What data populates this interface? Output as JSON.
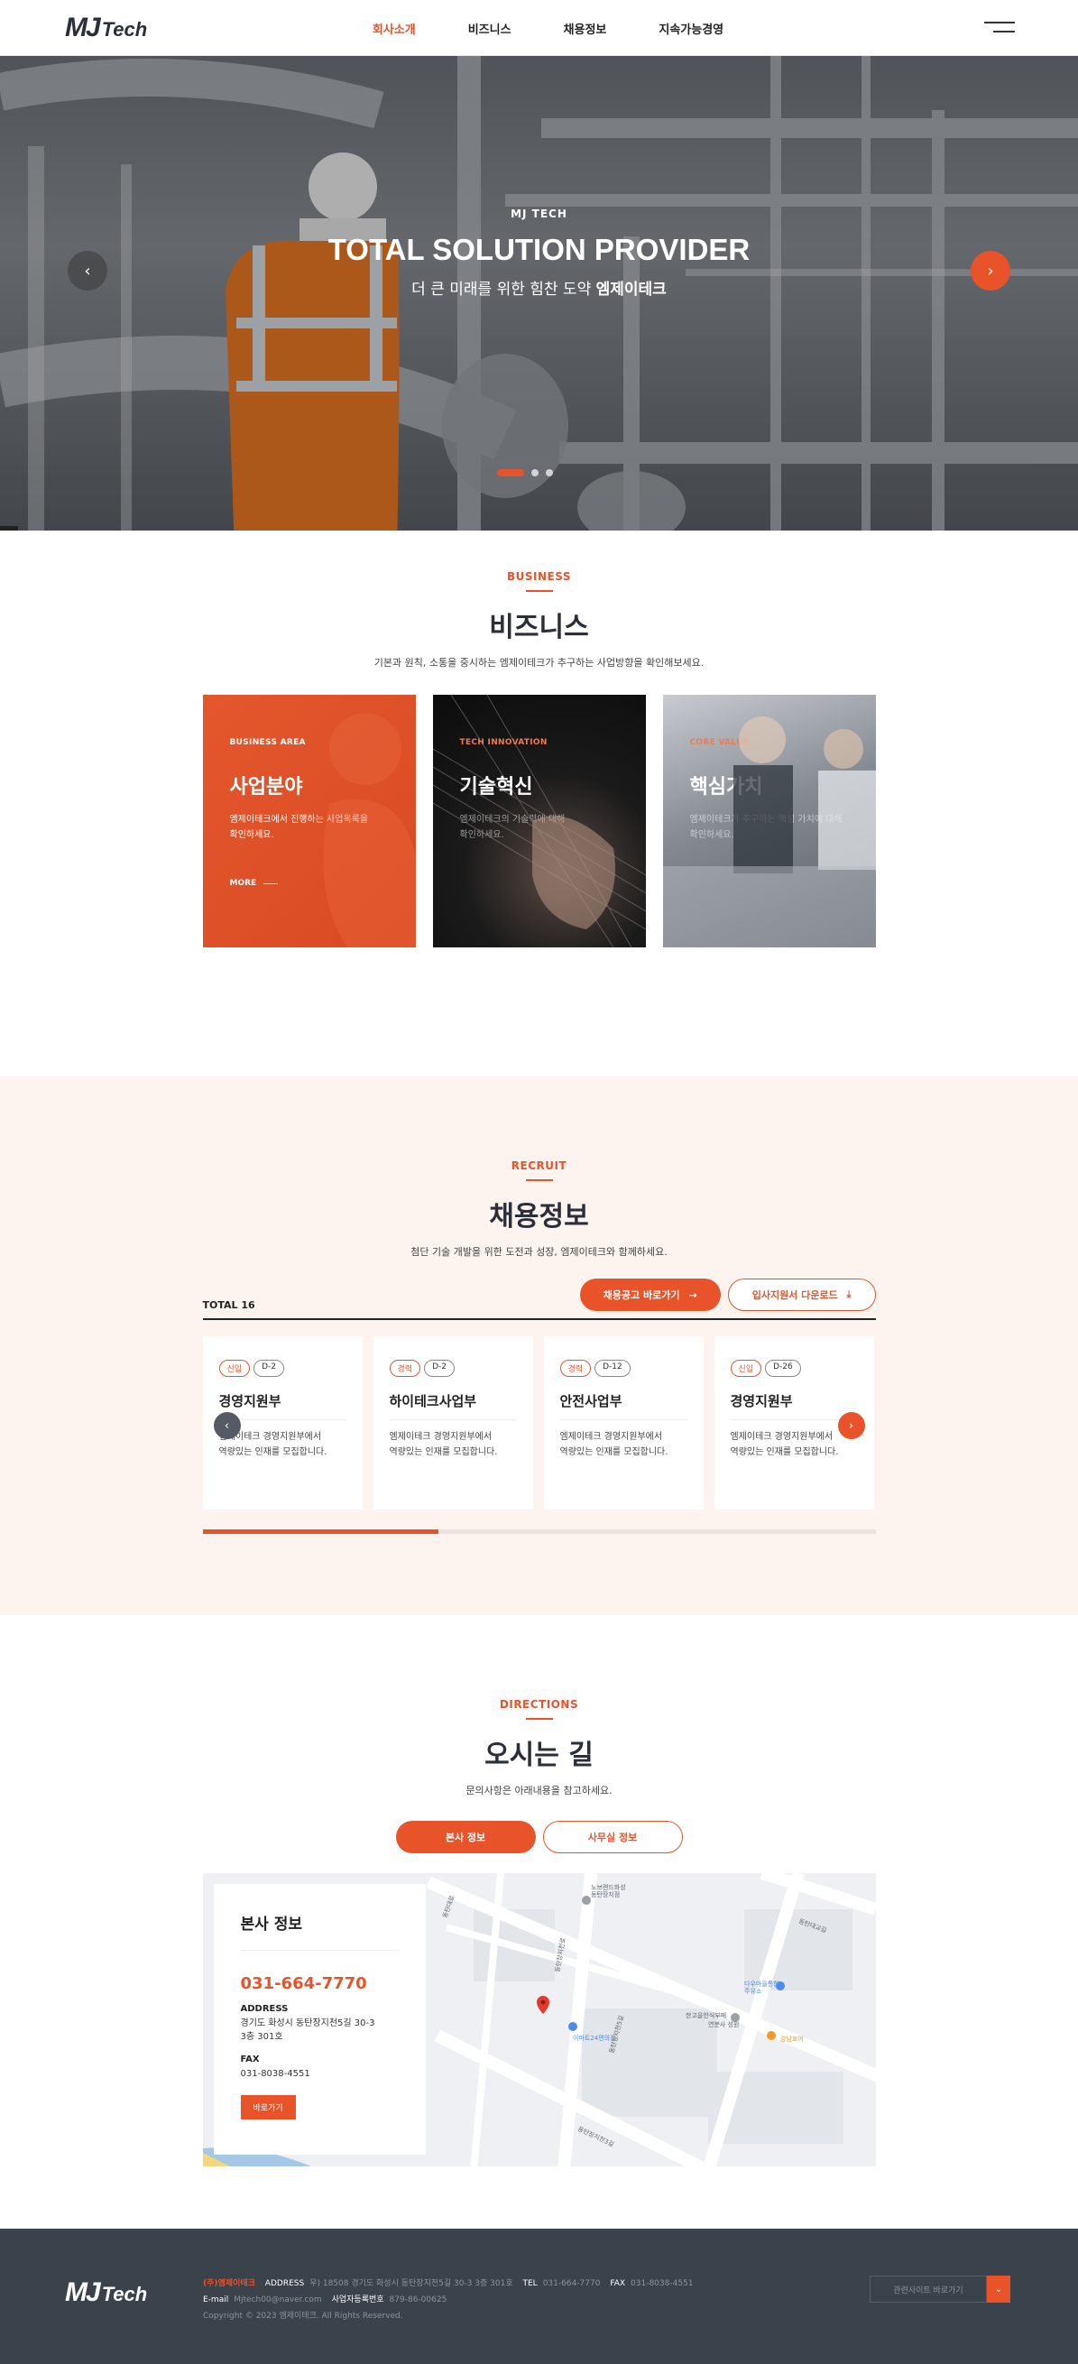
{
  "header": {
    "logo_mj": "MJ",
    "logo_tech": "Tech",
    "nav": [
      {
        "label": "회사소개",
        "active": true
      },
      {
        "label": "비즈니스",
        "active": false
      },
      {
        "label": "채용정보",
        "active": false
      },
      {
        "label": "지속가능경영",
        "active": false
      }
    ]
  },
  "hero": {
    "eyebrow": "MJ TECH",
    "title": "TOTAL SOLUTION PROVIDER",
    "subtitle": "더 큰 미래를 위한 힘찬 도약",
    "subtitle_bold": "엠제이테크",
    "prev_icon": "chevron-left-icon",
    "next_icon": "chevron-right-icon",
    "slide_count": 3,
    "active_slide": 1
  },
  "business": {
    "eyebrow": "BUSINESS",
    "title": "비즈니스",
    "desc": "기본과 원칙, 소통을 중시하는 엠제이테크가 추구하는 사업방향을 확인해보세요.",
    "cards": [
      {
        "eyebrow": "BUSINESS AREA",
        "title": "사업분야",
        "desc1": "엠제이테크에서 진행하는 사업목록을",
        "desc2": "확인하세요.",
        "more": "MORE"
      },
      {
        "eyebrow": "TECH INNOVATION",
        "title": "기술혁신",
        "desc1": "엠제이테크의 기술력에 대해",
        "desc2": "확인하세요."
      },
      {
        "eyebrow": "CORE VALUE",
        "title": "핵심가치",
        "desc1": "엠제이테크가 추구하는 핵심 가치에 대해",
        "desc2": "확인하세요."
      }
    ]
  },
  "recruit": {
    "eyebrow": "RECRUIT",
    "title": "채용정보",
    "desc": "첨단 기술 개발을 위한 도전과 성장, 엠제이테크와 함께하세요.",
    "total": "TOTAL 16",
    "btn_notice": "채용공고 바로가기",
    "btn_download": "입사지원서 다운로드",
    "progress": 0.35,
    "cards": [
      {
        "type": "신입",
        "dday": "D-2",
        "dept": "경영지원부",
        "desc1": "엠제이테크 경영지원부에서",
        "desc2": "역량있는 인재를 모집합니다."
      },
      {
        "type": "경력",
        "dday": "D-2",
        "dept": "하이테크사업부",
        "desc1": "엠제이테크 경영지원부에서",
        "desc2": "역량있는 인재를 모집합니다."
      },
      {
        "type": "경력",
        "dday": "D-12",
        "dept": "안전사업부",
        "desc1": "엠제이테크 경영지원부에서",
        "desc2": "역량있는 인재를 모집합니다."
      },
      {
        "type": "신입",
        "dday": "D-26",
        "dept": "경영지원부",
        "desc1": "엠제이테크 경영지원부에서",
        "desc2": "역량있는 인재를 모집합니다."
      }
    ]
  },
  "directions": {
    "eyebrow": "DIRECTIONS",
    "title": "오시는 길",
    "desc": "문의사항은 아래내용을 참고하세요.",
    "tab_hq": "본사 정보",
    "tab_office": "사무실 정보",
    "info": {
      "title": "본사 정보",
      "tel": "031-664-7770",
      "address_label": "ADDRESS",
      "address1": "경기도 화성시 동탄장지천5길 30-3",
      "address2": "3층 301호",
      "fax_label": "FAX",
      "fax": "031-8038-4551",
      "btn": "바로가기"
    },
    "map_labels": [
      "동탄대로",
      "노브렌드화성 동탄장지점",
      "동탄장지천5길",
      "동탄장지천로",
      "동탄대교길",
      "이마트24편의점 편의점",
      "동탄장지천3길",
      "다우마을통합 주유소",
      "한고을한식부페",
      "연분사 성원",
      "강남표어"
    ]
  },
  "footer": {
    "logo_mj": "MJ",
    "logo_tech": "Tech",
    "org": "(주)엠제이테크",
    "address_label": "ADDRESS",
    "address": "우) 18508 경기도 화성시 동탄장지천5길 30-3 3층 301호",
    "tel_label": "TEL",
    "tel": "031-664-7770",
    "fax_label": "FAX",
    "fax": "031-8038-4551",
    "email_label": "E-mail",
    "email": "Mjtech00@naver.com",
    "biz_label": "사업자등록번호",
    "biz_no": "879-86-00625",
    "copyright": "Copyright © 2023 엠제이테크. All Rights Reserved.",
    "family_site": "관련사이트 바로가기"
  }
}
